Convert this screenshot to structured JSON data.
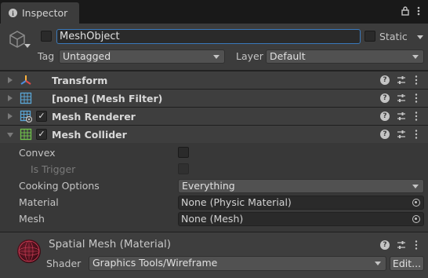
{
  "tab": {
    "title": "Inspector"
  },
  "header": {
    "object_name": "MeshObject",
    "static_label": "Static",
    "tag_label": "Tag",
    "tag_value": "Untagged",
    "layer_label": "Layer",
    "layer_value": "Default"
  },
  "components": [
    {
      "title": "Transform",
      "icon": "transform-icon",
      "has_checkbox": false
    },
    {
      "title": "[none] (Mesh Filter)",
      "icon": "mesh-filter-icon",
      "has_checkbox": false
    },
    {
      "title": "Mesh Renderer",
      "icon": "mesh-renderer-icon",
      "has_checkbox": true,
      "checked": true
    },
    {
      "title": "Mesh Collider",
      "icon": "mesh-collider-icon",
      "has_checkbox": true,
      "checked": true
    }
  ],
  "collider": {
    "convex_label": "Convex",
    "is_trigger_label": "Is Trigger",
    "cooking_label": "Cooking Options",
    "cooking_value": "Everything",
    "material_label": "Material",
    "material_value": "None (Physic Material)",
    "mesh_label": "Mesh",
    "mesh_value": "None (Mesh)"
  },
  "material_section": {
    "title": "Spatial Mesh (Material)",
    "shader_label": "Shader",
    "shader_value": "Graphics Tools/Wireframe",
    "edit_label": "Edit..."
  },
  "colors": {
    "focus_border": "#3a79bb",
    "collider_icon": "#6fc24b",
    "mesh_icon": "#5aa6d6"
  }
}
